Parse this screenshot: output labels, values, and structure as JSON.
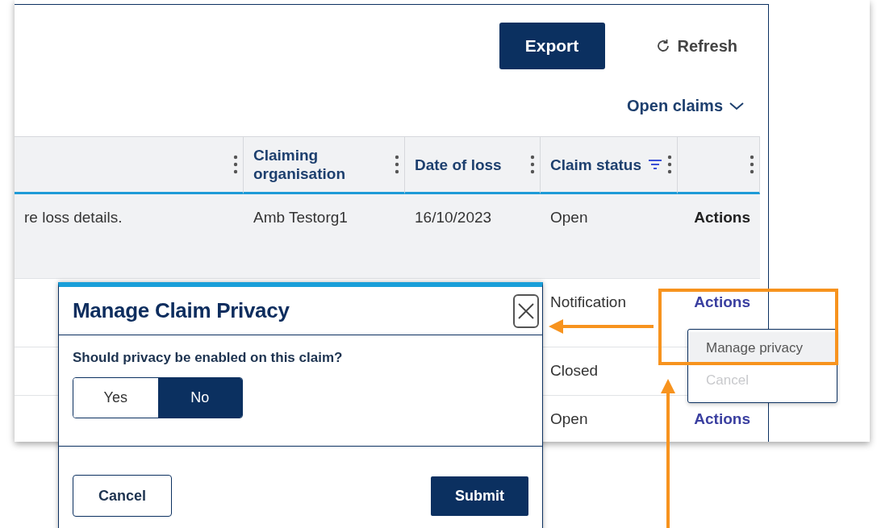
{
  "toolbar": {
    "export": "Export",
    "refresh": "Refresh"
  },
  "filter": {
    "label": "Open claims"
  },
  "table": {
    "columns": [
      {
        "kind": "blank",
        "filtered": false
      },
      {
        "kind": "text",
        "label": "Claiming organisation",
        "filtered": false
      },
      {
        "kind": "text",
        "label": "Date of loss",
        "filtered": false
      },
      {
        "kind": "text",
        "label": "Claim status",
        "filtered": true
      },
      {
        "kind": "blank",
        "filtered": false
      }
    ],
    "rows": [
      {
        "highlighted": true,
        "column_1": "re loss details.",
        "organisation": "Amb Testorg1",
        "date_of_loss": "16/10/2023",
        "claim_status": "Open",
        "action": "Actions"
      },
      {
        "highlighted": false,
        "claim_status": "Notification",
        "action": "Actions"
      },
      {
        "highlighted": false,
        "claim_status": "Closed"
      },
      {
        "highlighted": false,
        "claim_status": "Open",
        "action": "Actions"
      }
    ]
  },
  "actions_menu": {
    "items": [
      {
        "label": "Manage privacy",
        "highlighted": true,
        "disabled": false
      },
      {
        "label": "Cancel",
        "highlighted": false,
        "disabled": true
      }
    ]
  },
  "dialog": {
    "title": "Manage Claim Privacy",
    "question": "Should privacy be enabled on this claim?",
    "options": [
      {
        "label": "Yes",
        "selected": false
      },
      {
        "label": "No",
        "selected": true
      }
    ],
    "cancel": "Cancel",
    "submit": "Submit"
  }
}
